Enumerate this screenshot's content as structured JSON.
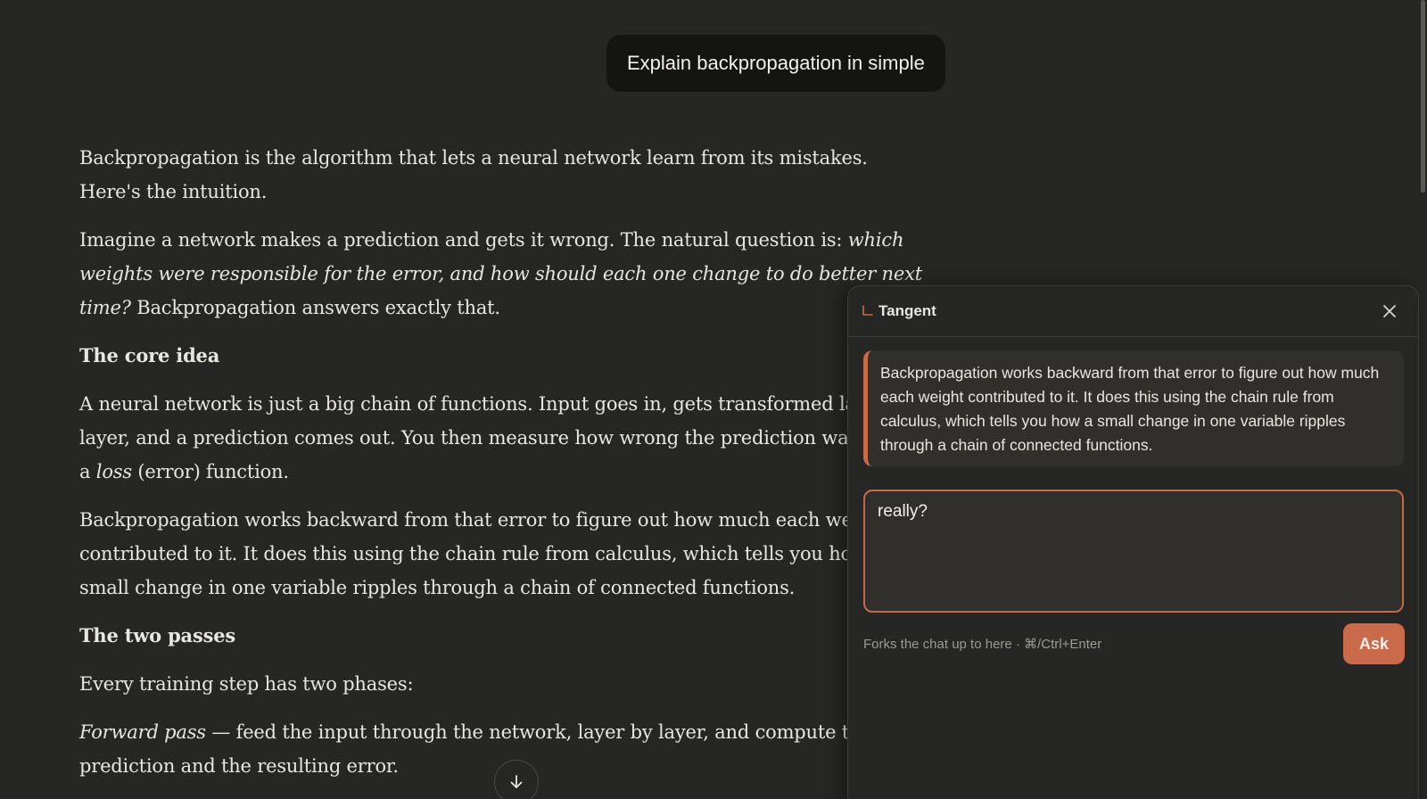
{
  "user_message": "Explain backpropagation in simple",
  "response": {
    "para1": "Backpropagation is the algorithm that lets a neural network learn from its mistakes. Here's the intuition.",
    "para2_a": "Imagine a network makes a prediction and gets it wrong. The natural question is: ",
    "para2_em": "which weights were responsible for the error, and how should each one change to do better next time?",
    "para2_b": " Backpropagation answers exactly that.",
    "heading1": "The core idea",
    "para3_a": "A neural network is just a big chain of functions. Input goes in, gets transformed layer by layer, and a prediction comes out. You then measure how wrong the prediction was using a ",
    "para3_em": "loss",
    "para3_b": " (error) function.",
    "para4": "Backpropagation works backward from that error to figure out how much each weight contributed to it. It does this using the chain rule from calculus, which tells you how a small change in one variable ripples through a chain of connected functions.",
    "heading2": "The two passes",
    "para5": "Every training step has two phases:",
    "para6_em": "Forward pass",
    "para6_b": " — feed the input through the network, layer by layer, and compute the prediction and the resulting error."
  },
  "tangent": {
    "title": "Tangent",
    "quote": "Backpropagation works backward from that error to figure out how much each weight contributed to it. It does this using the chain rule from calculus, which tells you how a small change in one variable ripples through a chain of connected functions.",
    "input_value": "really?",
    "hint": "Forks the chat up to here · ⌘/Ctrl+Enter",
    "ask_label": "Ask"
  },
  "icons": {
    "tangent": "tangent-branch-icon",
    "close": "close-icon",
    "scroll": "arrow-down-icon"
  },
  "colors": {
    "background": "#262624",
    "accent": "#c96a4b",
    "user_bubble": "#141413"
  }
}
